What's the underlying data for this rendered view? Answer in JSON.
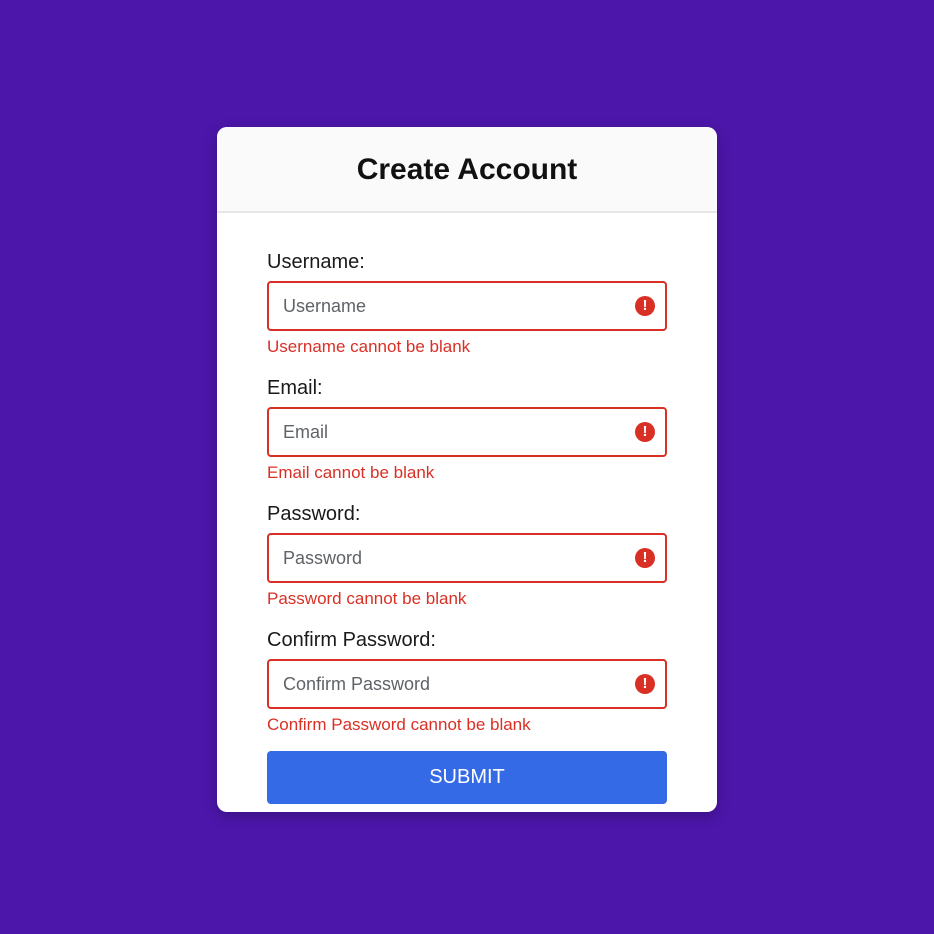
{
  "form": {
    "title": "Create Account",
    "fields": [
      {
        "label": "Username:",
        "placeholder": "Username",
        "value": "",
        "error": "Username cannot be blank"
      },
      {
        "label": "Email:",
        "placeholder": "Email",
        "value": "",
        "error": "Email cannot be blank"
      },
      {
        "label": "Password:",
        "placeholder": "Password",
        "value": "",
        "error": "Password cannot be blank"
      },
      {
        "label": "Confirm Password:",
        "placeholder": "Confirm Password",
        "value": "",
        "error": "Confirm Password cannot be blank"
      }
    ],
    "submit_label": "SUBMIT",
    "error_icon": "exclamation-circle-icon"
  },
  "colors": {
    "background": "#4c16aa",
    "card": "#ffffff",
    "header": "#fafafa",
    "error": "#d93025",
    "primary_button": "#356ae6"
  }
}
